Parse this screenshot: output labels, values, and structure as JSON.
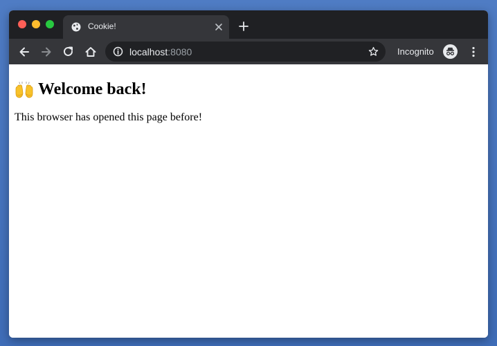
{
  "browser": {
    "tab_title": "Cookie!",
    "url_host": "localhost",
    "url_port": ":8080",
    "mode_label": "Incognito"
  },
  "icons": {
    "tab_favicon": "globe-icon",
    "tab_close": "close-icon",
    "new_tab": "plus-icon",
    "back": "arrow-left-icon",
    "forward": "arrow-right-icon",
    "reload": "reload-icon",
    "home": "home-icon",
    "site_info": "info-icon",
    "bookmark": "star-icon",
    "incognito": "incognito-icon",
    "menu": "kebab-menu-icon",
    "heading_emoji": "raised-hands-icon"
  },
  "page": {
    "heading": "Welcome back!",
    "body": "This browser has opened this page before!"
  },
  "colors": {
    "titlebar": "#1f2023",
    "toolbar": "#35363a",
    "omnibox": "#202124",
    "background": "#4f7cc4"
  }
}
